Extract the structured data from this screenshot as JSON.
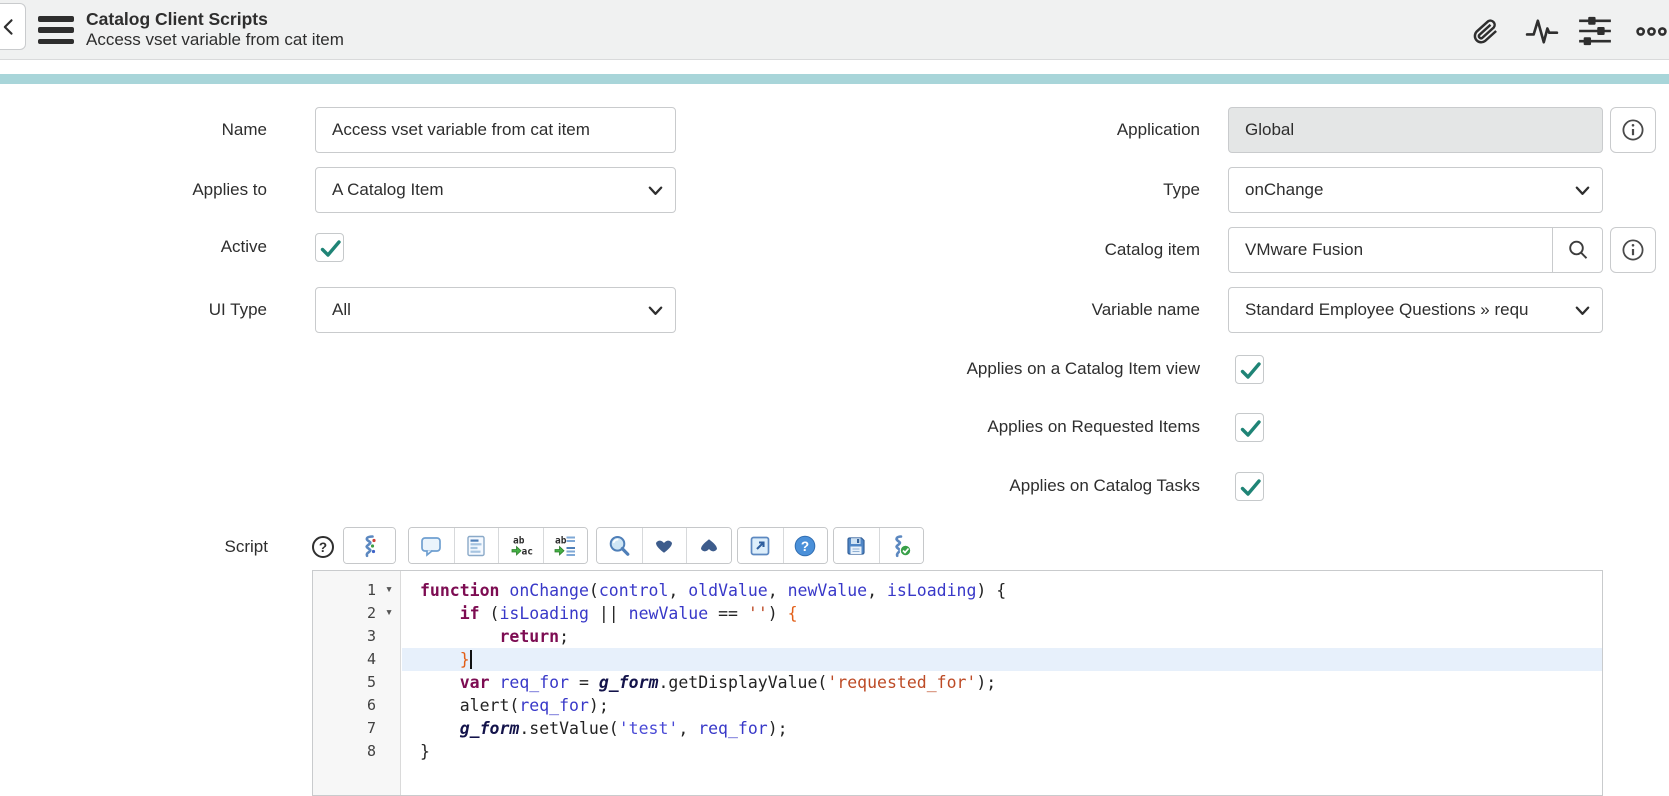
{
  "header": {
    "title": "Catalog Client Scripts",
    "subtitle": "Access vset variable from cat item",
    "actions": [
      {
        "name": "attachment-icon"
      },
      {
        "name": "activity-stream-icon"
      },
      {
        "name": "personalize-form-icon"
      },
      {
        "name": "more-options-icon"
      }
    ]
  },
  "accent_color": "#a8d5d9",
  "checkmark_color": "#1f8476",
  "form": {
    "left": [
      {
        "label": "Name",
        "type": "text",
        "value": "Access vset variable from cat item"
      },
      {
        "label": "Applies to",
        "type": "select",
        "value": "A Catalog Item"
      },
      {
        "label": "Active",
        "type": "checkbox",
        "checked": true
      },
      {
        "label": "UI Type",
        "type": "select",
        "value": "All"
      }
    ],
    "right": [
      {
        "label": "Application",
        "type": "readonly",
        "value": "Global",
        "info": true
      },
      {
        "label": "Type",
        "type": "select",
        "value": "onChange"
      },
      {
        "label": "Catalog item",
        "type": "lookup",
        "value": "VMware Fusion",
        "info": true
      },
      {
        "label": "Variable name",
        "type": "select",
        "value": "Standard Employee Questions » requ"
      },
      {
        "label": "Applies on a Catalog Item view",
        "type": "checkbox",
        "checked": true
      },
      {
        "label": "Applies on Requested Items",
        "type": "checkbox",
        "checked": true
      },
      {
        "label": "Applies on Catalog Tasks",
        "type": "checkbox",
        "checked": true
      }
    ]
  },
  "script": {
    "label": "Script",
    "toolbar_groups": [
      [
        "syntax-highlight-icon"
      ],
      [
        "comment-icon",
        "format-code-icon",
        "replace-icon",
        "replace-all-icon"
      ],
      [
        "search-icon",
        "find-next-icon",
        "find-previous-icon"
      ],
      [
        "open-window-icon",
        "editor-help-icon"
      ],
      [
        "save-icon",
        "script-validate-icon"
      ]
    ],
    "editor": {
      "active_line": 4,
      "fold_markers": [
        1,
        2
      ],
      "lines": [
        [
          [
            "kw",
            "function"
          ],
          [
            "pl",
            " "
          ],
          [
            "id",
            "onChange"
          ],
          [
            "pl",
            "("
          ],
          [
            "id",
            "control"
          ],
          [
            "pl",
            ", "
          ],
          [
            "id",
            "oldValue"
          ],
          [
            "pl",
            ", "
          ],
          [
            "id",
            "newValue"
          ],
          [
            "pl",
            ", "
          ],
          [
            "id",
            "isLoading"
          ],
          [
            "pl",
            ") {"
          ]
        ],
        [
          [
            "pl",
            "    "
          ],
          [
            "kw",
            "if"
          ],
          [
            "pl",
            " ("
          ],
          [
            "id",
            "isLoading"
          ],
          [
            "pl",
            " || "
          ],
          [
            "id",
            "newValue"
          ],
          [
            "pl",
            " == "
          ],
          [
            "str",
            "''"
          ],
          [
            "pl",
            ") "
          ],
          [
            "mb",
            "{"
          ]
        ],
        [
          [
            "pl",
            "        "
          ],
          [
            "kw",
            "return"
          ],
          [
            "pl",
            ";"
          ]
        ],
        [
          [
            "pl",
            "    "
          ],
          [
            "mb",
            "}"
          ],
          [
            "cur",
            ""
          ]
        ],
        [
          [
            "pl",
            "    "
          ],
          [
            "kw",
            "var"
          ],
          [
            "pl",
            " "
          ],
          [
            "id",
            "req_for"
          ],
          [
            "pl",
            " = "
          ],
          [
            "gf",
            "g_form"
          ],
          [
            "pl",
            ".getDisplayValue("
          ],
          [
            "str",
            "'requested_for'"
          ],
          [
            "pl",
            ");"
          ]
        ],
        [
          [
            "pl",
            "    alert("
          ],
          [
            "id",
            "req_for"
          ],
          [
            "pl",
            ");"
          ]
        ],
        [
          [
            "pl",
            "    "
          ],
          [
            "gf",
            "g_form"
          ],
          [
            "pl",
            ".setValue("
          ],
          [
            "str2",
            "'test'"
          ],
          [
            "pl",
            ", "
          ],
          [
            "id",
            "req_for"
          ],
          [
            "pl",
            ");"
          ]
        ],
        [
          [
            "pl",
            "}"
          ]
        ]
      ]
    }
  }
}
